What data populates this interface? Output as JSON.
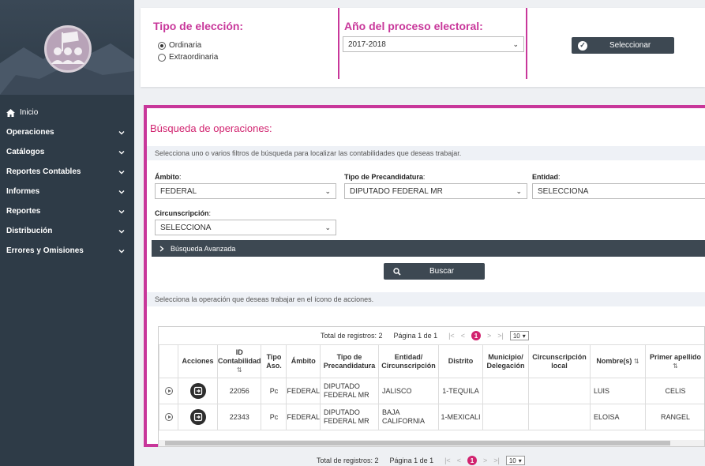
{
  "sidebar": {
    "items": [
      {
        "label": "Inicio",
        "icon": "home-icon"
      },
      {
        "label": "Operaciones"
      },
      {
        "label": "Catálogos"
      },
      {
        "label": "Reportes Contables"
      },
      {
        "label": "Informes"
      },
      {
        "label": "Reportes"
      },
      {
        "label": "Distribución"
      },
      {
        "label": "Errores y Omisiones"
      }
    ]
  },
  "top": {
    "election_type_title": "Tipo de elección:",
    "option_ordinaria": "Ordinaria",
    "option_extraordinaria": "Extraordinaria",
    "selected_option": "Ordinaria",
    "year_title": "Año del proceso electoral:",
    "year_value": "2017-2018",
    "select_button": "Seleccionar"
  },
  "search": {
    "title": "Búsqueda de operaciones:",
    "hint": "Selecciona uno o varios filtros de búsqueda para localizar las contabilidades que deseas trabajar.",
    "ambito_label": "Ámbito",
    "ambito_value": "FEDERAL",
    "precandidatura_label": "Tipo de Precandidatura",
    "precandidatura_value": "DIPUTADO FEDERAL MR",
    "entidad_label": "Entidad",
    "entidad_value": "SELECCIONA",
    "circunscripcion_label": "Circunscripción",
    "circunscripcion_value": "SELECCIONA",
    "advanced_label": "Búsqueda Avanzada",
    "search_button": "Buscar",
    "results_hint": "Selecciona la operación que deseas trabajar en el ícono de acciones."
  },
  "pager": {
    "total": "Total de registros: 2",
    "page": "Página 1 de 1",
    "current": "1",
    "page_size": "10"
  },
  "table": {
    "headers": [
      "",
      "Acciones",
      "ID Contabilidad",
      "Tipo Aso.",
      "Ámbito",
      "Tipo de Precandidatura",
      "Entidad/ Circunscripción",
      "Distrito",
      "Municipio/ Delegación",
      "Circunscripción local",
      "Nombre(s)",
      "Primer apellido"
    ],
    "rows": [
      {
        "id": "22056",
        "tipo": "Pc",
        "ambito": "FEDERAL",
        "precand": "DIPUTADO FEDERAL MR",
        "entidad": "JALISCO",
        "distrito": "1-TEQUILA",
        "municipio": "",
        "circ_local": "",
        "nombre": "LUIS",
        "apellido": "CELIS"
      },
      {
        "id": "22343",
        "tipo": "Pc",
        "ambito": "FEDERAL",
        "precand": "DIPUTADO FEDERAL MR",
        "entidad": "BAJA CALIFORNIA",
        "distrito": "1-MEXICALI",
        "municipio": "",
        "circ_local": "",
        "nombre": "ELOISA",
        "apellido": "RANGEL"
      }
    ]
  },
  "colors": {
    "accent": "#c8379a",
    "title": "#d1236f",
    "sidebar": "#2e3b47",
    "dark_button": "#3d4852"
  }
}
